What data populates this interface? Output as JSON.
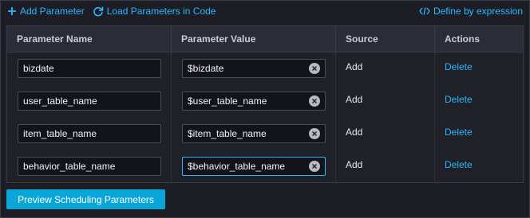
{
  "toolbar": {
    "add_parameter": "Add Parameter",
    "load_parameters": "Load Parameters in Code",
    "define_by_expression": "Define by expression"
  },
  "table": {
    "headers": [
      "Parameter Name",
      "Parameter Value",
      "Source",
      "Actions"
    ],
    "rows": [
      {
        "name": "bizdate",
        "value": "$bizdate",
        "source": "Add",
        "action": "Delete"
      },
      {
        "name": "user_table_name",
        "value": "$user_table_name",
        "source": "Add",
        "action": "Delete"
      },
      {
        "name": "item_table_name",
        "value": "$item_table_name",
        "source": "Add",
        "action": "Delete"
      },
      {
        "name": "behavior_table_name",
        "value": "$behavior_table_name",
        "source": "Add",
        "action": "Delete"
      }
    ]
  },
  "preview_button": "Preview Scheduling Parameters",
  "colors": {
    "accent": "#2cb7ff",
    "button": "#0aa6d8",
    "background": "#1d1e25"
  },
  "icons": {
    "add": "plus-icon",
    "load": "refresh-icon",
    "expression": "code-icon",
    "clear": "clear-icon"
  }
}
